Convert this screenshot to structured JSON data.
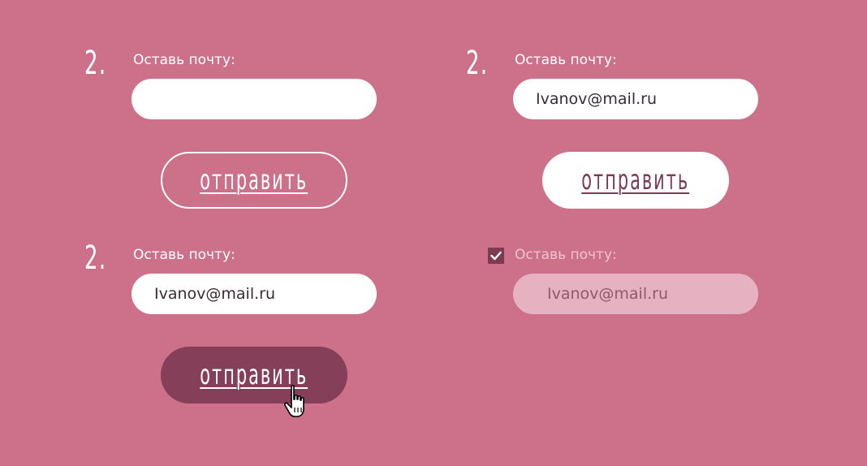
{
  "step_number": "2.",
  "field_label": "Оставь почту:",
  "email_value": "Ivanov@mail.ru",
  "submit_label": "отправить",
  "icons": {
    "checkbox": "checkmark-icon",
    "cursor": "hand-pointer-cursor-icon"
  },
  "colors": {
    "background": "#cd718b",
    "button_pressed": "#853f58",
    "button_text_dark": "#7d3a55",
    "field_disabled": "#e6b1c1"
  },
  "states": [
    {
      "name": "default",
      "email": "",
      "button_style": "outline"
    },
    {
      "name": "filled",
      "email": "Ivanov@mail.ru",
      "button_style": "solid"
    },
    {
      "name": "pressed",
      "email": "Ivanov@mail.ru",
      "button_style": "pressed"
    },
    {
      "name": "submitted",
      "email": "Ivanov@mail.ru",
      "checked": true
    }
  ]
}
